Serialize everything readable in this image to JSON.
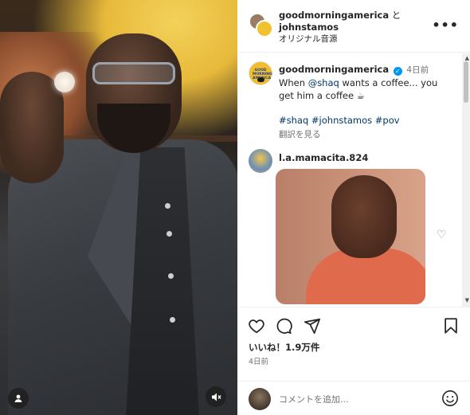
{
  "header": {
    "user1": "goodmorningamerica",
    "connector": "と",
    "user2": "johnstamos",
    "audio": "オリジナル音源",
    "more_icon": "more-horizontal-icon"
  },
  "caption": {
    "user": "goodmorningamerica",
    "verified_icon": "verified-badge-icon",
    "time": "4日前",
    "text_prefix": "When ",
    "mention": "@shaq",
    "text_suffix": " wants a coffee... you get him a coffee ☕",
    "hashtags": "#shaq #johnstamos #pov",
    "see_translation": "翻訳を見る",
    "avatar_logo": "GOOD MORNING AMERICA"
  },
  "comment": {
    "user": "l.a.mamacita.824",
    "heart_icon": "heart-outline-icon"
  },
  "actions": {
    "like_icon": "heart-icon",
    "comment_icon": "comment-icon",
    "share_icon": "share-icon",
    "save_icon": "bookmark-icon",
    "likes": "いいね！1.9万件",
    "age": "4日前"
  },
  "add_comment": {
    "placeholder": "コメントを追加...",
    "emoji_icon": "emoji-icon"
  },
  "video": {
    "user_icon": "user-tag-icon",
    "mute_icon": "muted-speaker-icon"
  }
}
